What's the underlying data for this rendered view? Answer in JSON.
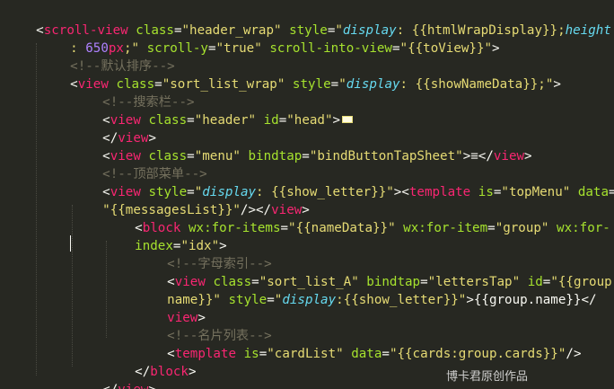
{
  "code": {
    "l1": {
      "lt": "<",
      "tag": "scroll-view",
      "a1": "class",
      "eq1": "=",
      "v1": "\"header_wrap\"",
      "a2": "style",
      "eq2": "=",
      "q_open": "\"",
      "k1": "display",
      "p1": ": {{htmlWrapDisplay}};",
      "k2": "height"
    },
    "l2": {
      "p1": ": ",
      "num": "650",
      "unit": "px",
      "p2": ";\"",
      "a1": "scroll-y",
      "eq1": "=",
      "v1": "\"true\"",
      "a2": "scroll-into-view",
      "eq2": "=",
      "v2": "\"{{toView}}\"",
      "gt": ">"
    },
    "l3": {
      "cm": "<!--默认排序-->"
    },
    "l4": {
      "lt": "<",
      "tag": "view",
      "a1": "class",
      "eq1": "=",
      "v1": "\"sort_list_wrap\"",
      "a2": "style",
      "eq2": "=",
      "q_open": "\"",
      "k1": "display",
      "p1": ": {{showNameData}};\"",
      "gt": ">"
    },
    "l5": {
      "cm": "<!--搜索栏-->"
    },
    "l6": {
      "lt": "<",
      "tag": "view",
      "a1": "class",
      "eq1": "=",
      "v1": "\"header\"",
      "a2": "id",
      "eq2": "=",
      "v2": "\"head\"",
      "gt": ">"
    },
    "l7": {
      "close": "</",
      "tag": "view",
      "gt": ">"
    },
    "l8": {
      "lt": "<",
      "tag": "view",
      "a1": "class",
      "eq1": "=",
      "v1": "\"menu\"",
      "a2": "bindtap",
      "eq2": "=",
      "v2": "\"bindButtonTapSheet\"",
      "gt": ">",
      "text": "≡",
      "close": "</",
      "tag2": "view",
      "gt2": ">"
    },
    "l9": {
      "cm": "<!--顶部菜单-->"
    },
    "l10": {
      "lt": "<",
      "tag": "view",
      "a1": "style",
      "eq1": "=",
      "q_open": "\"",
      "k1": "display",
      "p1": ": {{show_letter}}\"",
      "gt": ">",
      "lt2": "<",
      "tag2": "template",
      "a2": "is",
      "eq2": "=",
      "v2": "\"topMenu\"",
      "a3": "data",
      "eq3": "="
    },
    "l11": {
      "v1": "\"{{messagesList}}\"",
      "slash": "/>",
      "close": "</",
      "tag": "view",
      "gt": ">"
    },
    "l12": {
      "lt": "<",
      "tag": "block",
      "a1": "wx:for-items",
      "eq1": "=",
      "v1": "\"{{nameData}}\"",
      "a2": "wx:for-item",
      "eq2": "=",
      "v2": "\"group\"",
      "a3": "wx:for-"
    },
    "l13": {
      "a1": "index",
      "eq1": "=",
      "v1": "\"idx\"",
      "gt": ">"
    },
    "l14": {
      "cm": "<!--字母索引-->"
    },
    "l15": {
      "lt": "<",
      "tag": "view",
      "a1": "class",
      "eq1": "=",
      "v1": "\"sort_list_A\"",
      "a2": "bindtap",
      "eq2": "=",
      "v2": "\"lettersTap\"",
      "a3": "id",
      "eq3": "=",
      "v3": "\"{{group."
    },
    "l16": {
      "v1": "name}}\"",
      "a1": "style",
      "eq1": "=",
      "q_open": "\"",
      "k1": "display",
      "p1": ":{{show_letter}}\"",
      "gt": ">",
      "text": "{{group.name}}",
      "close": "</"
    },
    "l17": {
      "tag": "view",
      "gt": ">"
    },
    "l18": {
      "cm": "<!--名片列表-->"
    },
    "l19": {
      "lt": "<",
      "tag": "template",
      "a1": "is",
      "eq1": "=",
      "v1": "\"cardList\"",
      "a2": "data",
      "eq2": "=",
      "v2": "\"{{cards:group.cards}}\"",
      "slash": "/>"
    },
    "l20": {
      "close": "</",
      "tag": "block",
      "gt": ">"
    },
    "l21": {
      "close": "</",
      "tag": "view",
      "gt": ">"
    }
  },
  "watermark": "博卡君原创作品",
  "colors": {
    "background": "#272822",
    "tag": "#f92672",
    "attribute": "#a6e22e",
    "string": "#e6db74",
    "css_property": "#66d9ef",
    "number": "#ae81ff",
    "comment": "#75715e",
    "plain": "#f8f8f2"
  },
  "icons": {
    "fold_marker": "collapsed-fold-icon"
  }
}
